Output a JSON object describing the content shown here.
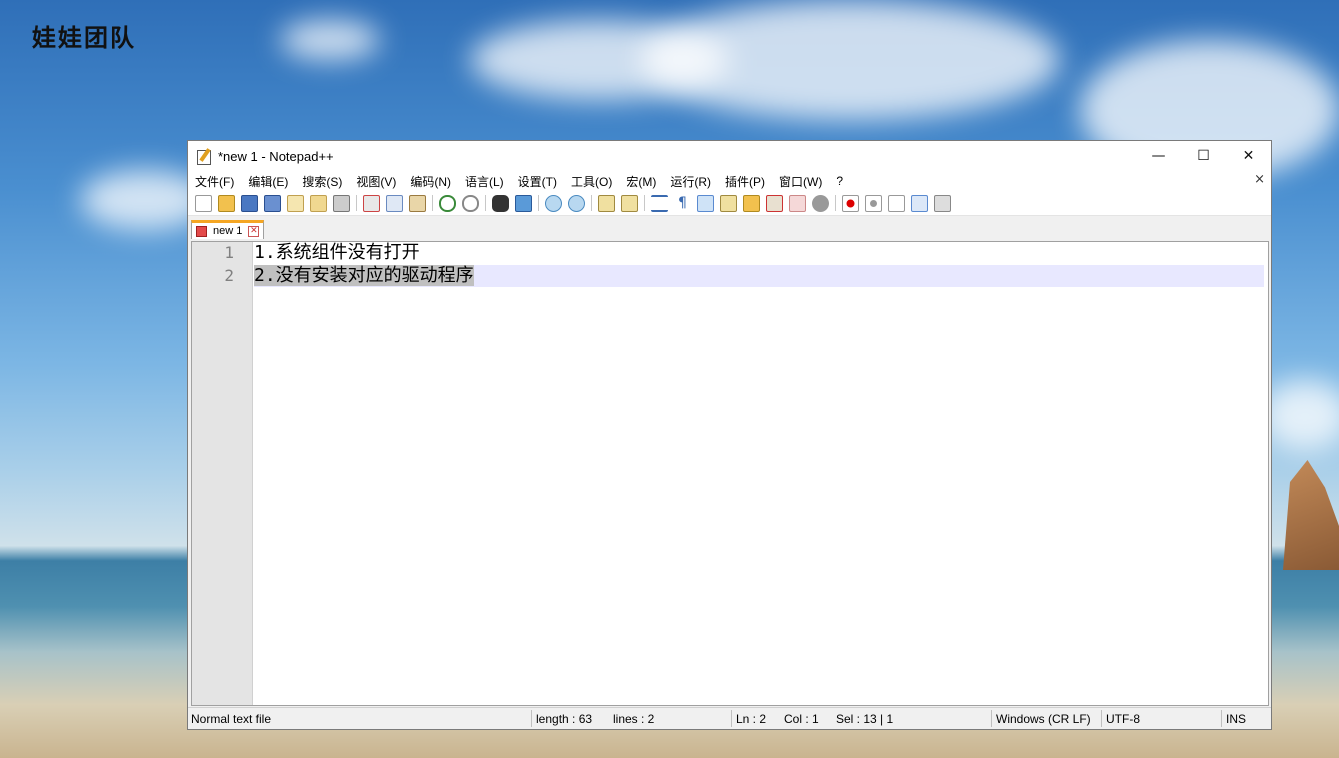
{
  "watermark": "娃娃团队",
  "window": {
    "title": "*new 1 - Notepad++",
    "controls": {
      "minimize": "—",
      "maximize": "☐",
      "close": "✕"
    }
  },
  "menu": {
    "items": [
      "文件(F)",
      "编辑(E)",
      "搜索(S)",
      "视图(V)",
      "编码(N)",
      "语言(L)",
      "设置(T)",
      "工具(O)",
      "宏(M)",
      "运行(R)",
      "插件(P)",
      "窗口(W)",
      "?"
    ],
    "close": "×"
  },
  "toolbar": {
    "icons": [
      "new-file-icon",
      "open-file-icon",
      "save-icon",
      "save-all-icon",
      "close-icon",
      "close-all-icon",
      "print-icon",
      "cut-icon",
      "copy-icon",
      "paste-icon",
      "undo-icon",
      "redo-icon",
      "find-icon",
      "replace-icon",
      "zoom-in-icon",
      "zoom-out-icon",
      "sync-vertical-icon",
      "sync-horizontal-icon",
      "word-wrap-icon",
      "show-all-chars-icon",
      "indent-guide-icon",
      "doc-map-icon",
      "function-list-icon",
      "folder-workspace-icon",
      "doc-switcher-icon",
      "monitor-icon",
      "record-macro-icon",
      "stop-record-icon",
      "play-macro-icon",
      "run-multiple-icon",
      "save-macro-icon"
    ]
  },
  "tab": {
    "label": "new 1",
    "close": "✕"
  },
  "editor": {
    "lines": [
      {
        "num": "1",
        "text": "1.系统组件没有打开"
      },
      {
        "num": "2",
        "text": "2.没有安装对应的驱动程序"
      }
    ]
  },
  "status": {
    "file_type": "Normal text file",
    "length": "length : 63",
    "lines": "lines : 2",
    "ln": "Ln : 2",
    "col": "Col : 1",
    "sel": "Sel : 13 | 1",
    "eol": "Windows (CR LF)",
    "encoding": "UTF-8",
    "mode": "INS"
  },
  "colors": {
    "accent_tab": "#f5a623",
    "current_line": "#e8e8ff",
    "selection": "#c0c0c0",
    "cursor": "#4b2a6a"
  }
}
